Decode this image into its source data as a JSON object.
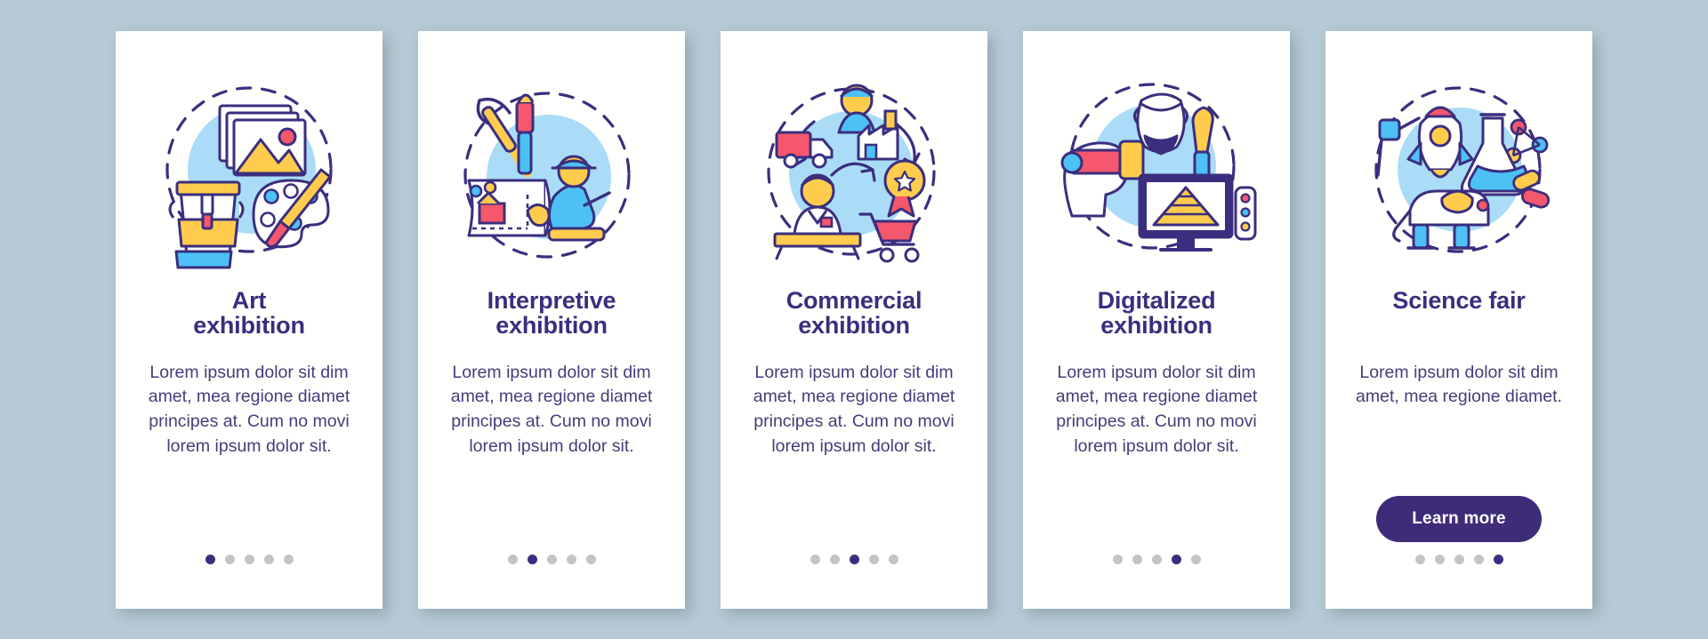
{
  "page": {
    "background_color": "#b6c9d4",
    "card_background": "#fffffd",
    "accent_color": "#3b2e7e",
    "dot_inactive_color": "#c4c4c4"
  },
  "screens": [
    {
      "illustration": "art-exhibition-illustration",
      "title_line1": "Art",
      "title_line2": "exhibition",
      "description": "Lorem ipsum dolor sit dim amet, mea regione diamet principes at. Cum no movi lorem ipsum dolor sit.",
      "dots_total": 5,
      "dot_active_index": 0,
      "cta_label": null
    },
    {
      "illustration": "interpretive-exhibition-illustration",
      "title_line1": "Interpretive",
      "title_line2": "exhibition",
      "description": "Lorem ipsum dolor sit dim amet, mea regione diamet principes at. Cum no movi lorem ipsum dolor sit.",
      "dots_total": 5,
      "dot_active_index": 1,
      "cta_label": null
    },
    {
      "illustration": "commercial-exhibition-illustration",
      "title_line1": "Commercial",
      "title_line2": "exhibition",
      "description": "Lorem ipsum dolor sit dim amet, mea regione diamet principes at. Cum no movi lorem ipsum dolor sit.",
      "dots_total": 5,
      "dot_active_index": 2,
      "cta_label": null
    },
    {
      "illustration": "digitalized-exhibition-illustration",
      "title_line1": "Digitalized",
      "title_line2": "exhibition",
      "description": "Lorem ipsum dolor sit dim amet, mea regione diamet principes at. Cum no movi lorem ipsum dolor sit.",
      "dots_total": 5,
      "dot_active_index": 3,
      "cta_label": null
    },
    {
      "illustration": "science-fair-illustration",
      "title_line1": "Science fair",
      "title_line2": "",
      "description": "Lorem ipsum dolor sit dim amet, mea regione diamet.",
      "dots_total": 5,
      "dot_active_index": 4,
      "cta_label": "Learn more"
    }
  ]
}
